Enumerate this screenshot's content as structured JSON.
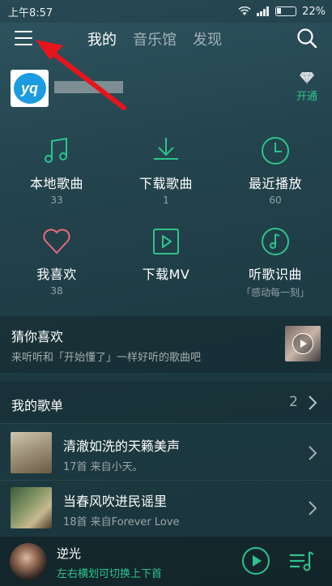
{
  "status_bar": {
    "time": "上午8:57",
    "battery": "22%"
  },
  "header": {
    "tabs": [
      {
        "label": "我的",
        "active": true
      },
      {
        "label": "音乐馆",
        "active": false
      },
      {
        "label": "发现",
        "active": false
      }
    ]
  },
  "profile": {
    "vip_label": "开通"
  },
  "grid": [
    {
      "label": "本地歌曲",
      "sub": "33",
      "icon": "music-note-icon"
    },
    {
      "label": "下载歌曲",
      "sub": "1",
      "icon": "download-icon"
    },
    {
      "label": "最近播放",
      "sub": "60",
      "icon": "clock-icon"
    },
    {
      "label": "我喜欢",
      "sub": "38",
      "icon": "heart-icon"
    },
    {
      "label": "下载MV",
      "sub": "",
      "icon": "play-box-icon"
    },
    {
      "label": "听歌识曲",
      "sub": "「感动每一刻」",
      "icon": "recognize-music-icon"
    }
  ],
  "guess": {
    "title": "猜你喜欢",
    "subtitle": "来听听和「开始懂了」一样好听的歌曲吧"
  },
  "playlists": {
    "title": "我的歌单",
    "count": "2",
    "items": [
      {
        "name": "清澈如洗的天籁美声",
        "meta": "17首 来自小天。"
      },
      {
        "name": "当春风吹进民谣里",
        "meta": "18首 来自Forever Love"
      }
    ]
  },
  "player": {
    "song": "逆光",
    "hint": "左右横划可切换上下首"
  },
  "colors": {
    "accent": "#2ec48a",
    "background": "#23434d",
    "arrow": "#e8141b"
  }
}
